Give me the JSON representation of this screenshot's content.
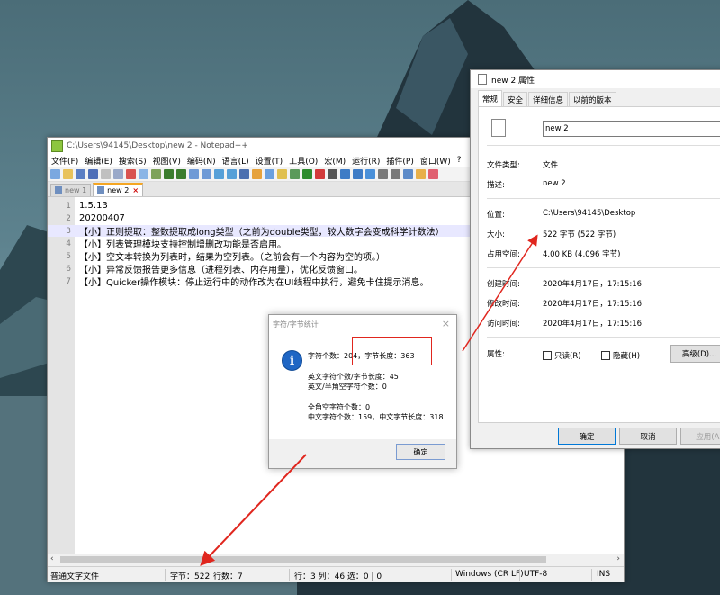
{
  "notepad": {
    "title": "C:\\Users\\94145\\Desktop\\new 2 - Notepad++",
    "menu": [
      "文件(F)",
      "编辑(E)",
      "搜索(S)",
      "视图(V)",
      "编码(N)",
      "语言(L)",
      "设置(T)",
      "工具(O)",
      "宏(M)",
      "运行(R)",
      "插件(P)",
      "窗口(W)",
      "?"
    ],
    "tabs": [
      {
        "label": "new 1",
        "active": false
      },
      {
        "label": "new 2",
        "active": true
      }
    ],
    "lines": [
      {
        "num": "1",
        "text": "1.5.13"
      },
      {
        "num": "2",
        "text": "20200407"
      },
      {
        "num": "3",
        "text": "【小】正则提取：整数提取成long类型（之前为double类型，较大数字会变成科学计数法）"
      },
      {
        "num": "4",
        "text": "【小】列表管理模块支持控制增删改功能是否启用。"
      },
      {
        "num": "5",
        "text": "【小】空文本转换为列表时，结果为空列表。（之前会有一个内容为空的项。）"
      },
      {
        "num": "6",
        "text": "【小】异常反馈报告更多信息（进程列表、内存用量），优化反馈窗口。"
      },
      {
        "num": "7",
        "text": "【小】Quicker操作模块：停止运行中的动作改为在UI线程中执行，避免卡住提示消息。"
      }
    ],
    "status": {
      "filetype": "普通文字文件",
      "bytes": "字节：522",
      "lines_count": "行数：7",
      "position": "行：3    列：46    选：0 | 0",
      "eol": "Windows (CR LF)",
      "encoding": "UTF-8",
      "ins": "INS"
    }
  },
  "stats_dialog": {
    "title": "字符/字节统计",
    "close": "×",
    "info_icon": "i",
    "chars_line": "字符个数：204，字节长度：363",
    "en_line": "英文字符个数/字节长度：45",
    "en_half_line": "英文/半角空字符个数：0",
    "full_line": "全角空字符个数：0",
    "cn_line": "中文字符个数：159，中文字节长度：318",
    "ok": "确定"
  },
  "properties": {
    "title": "new 2 属性",
    "tabs": [
      "常规",
      "安全",
      "详细信息",
      "以前的版本"
    ],
    "filename": "new 2",
    "file_type_label": "文件类型:",
    "file_type": "文件",
    "desc_label": "描述:",
    "desc": "new 2",
    "location_label": "位置:",
    "location": "C:\\Users\\94145\\Desktop",
    "size_label": "大小:",
    "size": "522 字节 (522 字节)",
    "disk_label": "占用空间:",
    "disk": "4.00 KB (4,096 字节)",
    "created_label": "创建时间:",
    "created": "2020年4月17日，17:15:16",
    "modified_label": "修改时间:",
    "modified": "2020年4月17日，17:15:16",
    "accessed_label": "访问时间:",
    "accessed": "2020年4月17日，17:15:16",
    "attr_label": "属性:",
    "readonly": "只读(R)",
    "hidden": "隐藏(H)",
    "advanced": "高级(D)...",
    "ok": "确定",
    "cancel": "取消",
    "apply": "应用(A)"
  },
  "colors": {
    "annotation": "#e0261e",
    "highlight_line": "#e8e8ff",
    "info_blue": "#1f66c4"
  }
}
